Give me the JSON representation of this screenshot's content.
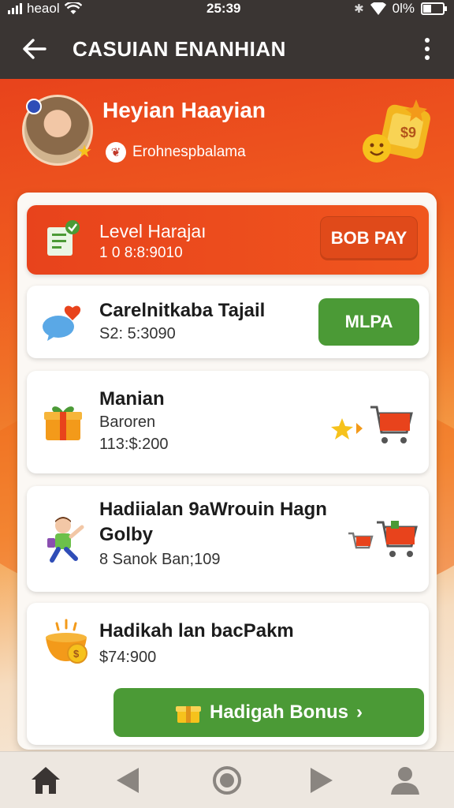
{
  "status_bar": {
    "carrier": "heaol",
    "time": "25:39",
    "battery_text": "0l%"
  },
  "app_bar": {
    "title": "CASUIAN ENANHIAN",
    "back_icon": "arrow-left-icon",
    "menu_icon": "more-vertical-icon"
  },
  "profile": {
    "name": "Heyian Haayian",
    "subtitle": "Erohnespbalama"
  },
  "cards": {
    "level": {
      "title": "Level Harajaı",
      "value": "1 0 8:8:9010",
      "button": "BOB PAY"
    },
    "c2": {
      "title": "Carelnitkaba Tajail",
      "value": "S2: 5:3090",
      "button": "MLPA"
    },
    "c3": {
      "title": "Manian",
      "line2": "Baroren",
      "value": "113:$:200"
    },
    "c4": {
      "title": "Hadiialan 9aWrouin Hagn Golby",
      "value": "8 Sanok Ban;109"
    },
    "c5": {
      "title": "Hadikah lan bacPakm",
      "value": "$74:900",
      "button": "Hadigah Bonus",
      "button_arrow": "›"
    }
  },
  "nav": {
    "items": [
      "home-icon",
      "back-triangle-icon",
      "home-circle-icon",
      "forward-triangle-icon",
      "profile-icon"
    ]
  },
  "colors": {
    "primary_orange": "#e8431c",
    "green": "#4b9a36",
    "dark_bar": "#3a3533"
  }
}
